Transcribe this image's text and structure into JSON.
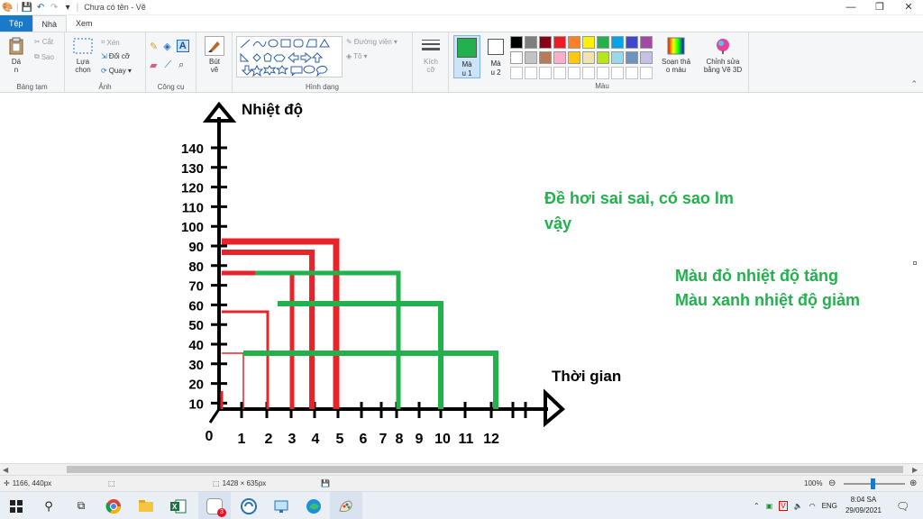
{
  "window": {
    "title": "Chưa có tên - Vẽ",
    "controls": {
      "minimize": "—",
      "maximize": "❐",
      "close": "✕"
    }
  },
  "tabs": [
    {
      "label": "Tệp"
    },
    {
      "label": "Nhà"
    },
    {
      "label": "Xem"
    }
  ],
  "ribbon": {
    "clipboard": {
      "paste": "Dá\nn",
      "cut": "Cắt",
      "copy": "Sao",
      "group": "Bảng tạm"
    },
    "image": {
      "select": "Lựa\nchọn",
      "crop": "Xén",
      "resize": "Đổi cỡ",
      "rotate": "Quay",
      "group": "Ảnh"
    },
    "tools": {
      "group": "Công cụ"
    },
    "brushes": {
      "label": "Bút\nvẽ"
    },
    "shapes": {
      "outline": "Đường viền",
      "fill": "Tô",
      "group": "Hình dạng"
    },
    "size": {
      "label": "Kích\ncỡ"
    },
    "color1": {
      "label": "Mà\nu 1",
      "value": "#22b14c"
    },
    "color2": {
      "label": "Mà\nu 2",
      "value": "#ffffff"
    },
    "palette_row1": [
      "#000000",
      "#7f7f7f",
      "#880015",
      "#ed1c24",
      "#ff7f27",
      "#fff200",
      "#22b14c",
      "#00a2e8",
      "#3f48cc",
      "#a349a4"
    ],
    "palette_row2": [
      "#ffffff",
      "#c3c3c3",
      "#b97a57",
      "#ffaec9",
      "#ffc90e",
      "#efe4b0",
      "#b5e61d",
      "#99d9ea",
      "#7092be",
      "#c8bfe7"
    ],
    "edit_colors": "Soạn thả\no màu",
    "paint3d": "Chỉnh sửa\nbằng Vẽ 3D",
    "colors_group": "Màu"
  },
  "drawing": {
    "y_axis_title": "Nhiệt độ",
    "x_axis_title": "Thời gian",
    "y_ticks": [
      "140",
      "130",
      "120",
      "110",
      "100",
      "90",
      "80",
      "70",
      "60",
      "50",
      "40",
      "30",
      "20",
      "10"
    ],
    "origin": "0",
    "x_ticks": [
      "1",
      "2",
      "3",
      "4",
      "5",
      "6",
      "7",
      "8",
      "9",
      "10",
      "11",
      "12"
    ],
    "note1_line1": "Đề hơi sai sai, có sao lm",
    "note1_line2": "vậy",
    "legend_red": "Màu đỏ nhiệt độ tăng",
    "legend_green": "Màu xanh nhiệt độ giảm",
    "red": "#e8242b",
    "green": "#22b14c"
  },
  "status": {
    "cursor": "1166, 440px",
    "canvas_size": "1428 × 635px",
    "zoom": "100%"
  },
  "taskbar": {
    "lang": "ENG",
    "time": "8:04 SA",
    "date": "29/09/2021",
    "badge": "3"
  }
}
